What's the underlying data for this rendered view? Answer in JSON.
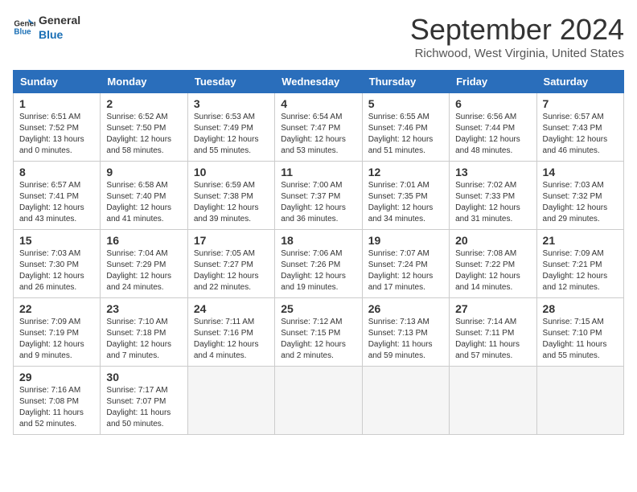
{
  "logo": {
    "line1": "General",
    "line2": "Blue"
  },
  "title": "September 2024",
  "subtitle": "Richwood, West Virginia, United States",
  "headers": [
    "Sunday",
    "Monday",
    "Tuesday",
    "Wednesday",
    "Thursday",
    "Friday",
    "Saturday"
  ],
  "weeks": [
    [
      {
        "day": "1",
        "sunrise": "6:51 AM",
        "sunset": "7:52 PM",
        "daylight": "13 hours and 0 minutes."
      },
      {
        "day": "2",
        "sunrise": "6:52 AM",
        "sunset": "7:50 PM",
        "daylight": "12 hours and 58 minutes."
      },
      {
        "day": "3",
        "sunrise": "6:53 AM",
        "sunset": "7:49 PM",
        "daylight": "12 hours and 55 minutes."
      },
      {
        "day": "4",
        "sunrise": "6:54 AM",
        "sunset": "7:47 PM",
        "daylight": "12 hours and 53 minutes."
      },
      {
        "day": "5",
        "sunrise": "6:55 AM",
        "sunset": "7:46 PM",
        "daylight": "12 hours and 51 minutes."
      },
      {
        "day": "6",
        "sunrise": "6:56 AM",
        "sunset": "7:44 PM",
        "daylight": "12 hours and 48 minutes."
      },
      {
        "day": "7",
        "sunrise": "6:57 AM",
        "sunset": "7:43 PM",
        "daylight": "12 hours and 46 minutes."
      }
    ],
    [
      {
        "day": "8",
        "sunrise": "6:57 AM",
        "sunset": "7:41 PM",
        "daylight": "12 hours and 43 minutes."
      },
      {
        "day": "9",
        "sunrise": "6:58 AM",
        "sunset": "7:40 PM",
        "daylight": "12 hours and 41 minutes."
      },
      {
        "day": "10",
        "sunrise": "6:59 AM",
        "sunset": "7:38 PM",
        "daylight": "12 hours and 39 minutes."
      },
      {
        "day": "11",
        "sunrise": "7:00 AM",
        "sunset": "7:37 PM",
        "daylight": "12 hours and 36 minutes."
      },
      {
        "day": "12",
        "sunrise": "7:01 AM",
        "sunset": "7:35 PM",
        "daylight": "12 hours and 34 minutes."
      },
      {
        "day": "13",
        "sunrise": "7:02 AM",
        "sunset": "7:33 PM",
        "daylight": "12 hours and 31 minutes."
      },
      {
        "day": "14",
        "sunrise": "7:03 AM",
        "sunset": "7:32 PM",
        "daylight": "12 hours and 29 minutes."
      }
    ],
    [
      {
        "day": "15",
        "sunrise": "7:03 AM",
        "sunset": "7:30 PM",
        "daylight": "12 hours and 26 minutes."
      },
      {
        "day": "16",
        "sunrise": "7:04 AM",
        "sunset": "7:29 PM",
        "daylight": "12 hours and 24 minutes."
      },
      {
        "day": "17",
        "sunrise": "7:05 AM",
        "sunset": "7:27 PM",
        "daylight": "12 hours and 22 minutes."
      },
      {
        "day": "18",
        "sunrise": "7:06 AM",
        "sunset": "7:26 PM",
        "daylight": "12 hours and 19 minutes."
      },
      {
        "day": "19",
        "sunrise": "7:07 AM",
        "sunset": "7:24 PM",
        "daylight": "12 hours and 17 minutes."
      },
      {
        "day": "20",
        "sunrise": "7:08 AM",
        "sunset": "7:22 PM",
        "daylight": "12 hours and 14 minutes."
      },
      {
        "day": "21",
        "sunrise": "7:09 AM",
        "sunset": "7:21 PM",
        "daylight": "12 hours and 12 minutes."
      }
    ],
    [
      {
        "day": "22",
        "sunrise": "7:09 AM",
        "sunset": "7:19 PM",
        "daylight": "12 hours and 9 minutes."
      },
      {
        "day": "23",
        "sunrise": "7:10 AM",
        "sunset": "7:18 PM",
        "daylight": "12 hours and 7 minutes."
      },
      {
        "day": "24",
        "sunrise": "7:11 AM",
        "sunset": "7:16 PM",
        "daylight": "12 hours and 4 minutes."
      },
      {
        "day": "25",
        "sunrise": "7:12 AM",
        "sunset": "7:15 PM",
        "daylight": "12 hours and 2 minutes."
      },
      {
        "day": "26",
        "sunrise": "7:13 AM",
        "sunset": "7:13 PM",
        "daylight": "11 hours and 59 minutes."
      },
      {
        "day": "27",
        "sunrise": "7:14 AM",
        "sunset": "7:11 PM",
        "daylight": "11 hours and 57 minutes."
      },
      {
        "day": "28",
        "sunrise": "7:15 AM",
        "sunset": "7:10 PM",
        "daylight": "11 hours and 55 minutes."
      }
    ],
    [
      {
        "day": "29",
        "sunrise": "7:16 AM",
        "sunset": "7:08 PM",
        "daylight": "11 hours and 52 minutes."
      },
      {
        "day": "30",
        "sunrise": "7:17 AM",
        "sunset": "7:07 PM",
        "daylight": "11 hours and 50 minutes."
      },
      null,
      null,
      null,
      null,
      null
    ]
  ]
}
